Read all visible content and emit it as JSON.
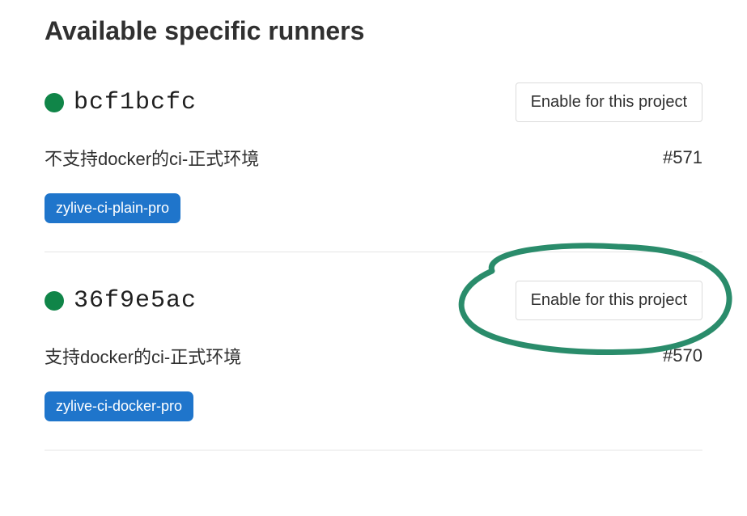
{
  "heading": "Available specific runners",
  "enable_label": "Enable for this project",
  "runners": [
    {
      "hash": "bcf1bcfc",
      "description": "不支持docker的ci-正式环境",
      "id": "#571",
      "tag": "zylive-ci-plain-pro",
      "annotated": false
    },
    {
      "hash": "36f9e5ac",
      "description": "支持docker的ci-正式环境",
      "id": "#570",
      "tag": "zylive-ci-docker-pro",
      "annotated": true
    }
  ],
  "colors": {
    "status_online": "#108548",
    "tag_bg": "#1f75cb",
    "annotation": "#2a8c6b"
  }
}
